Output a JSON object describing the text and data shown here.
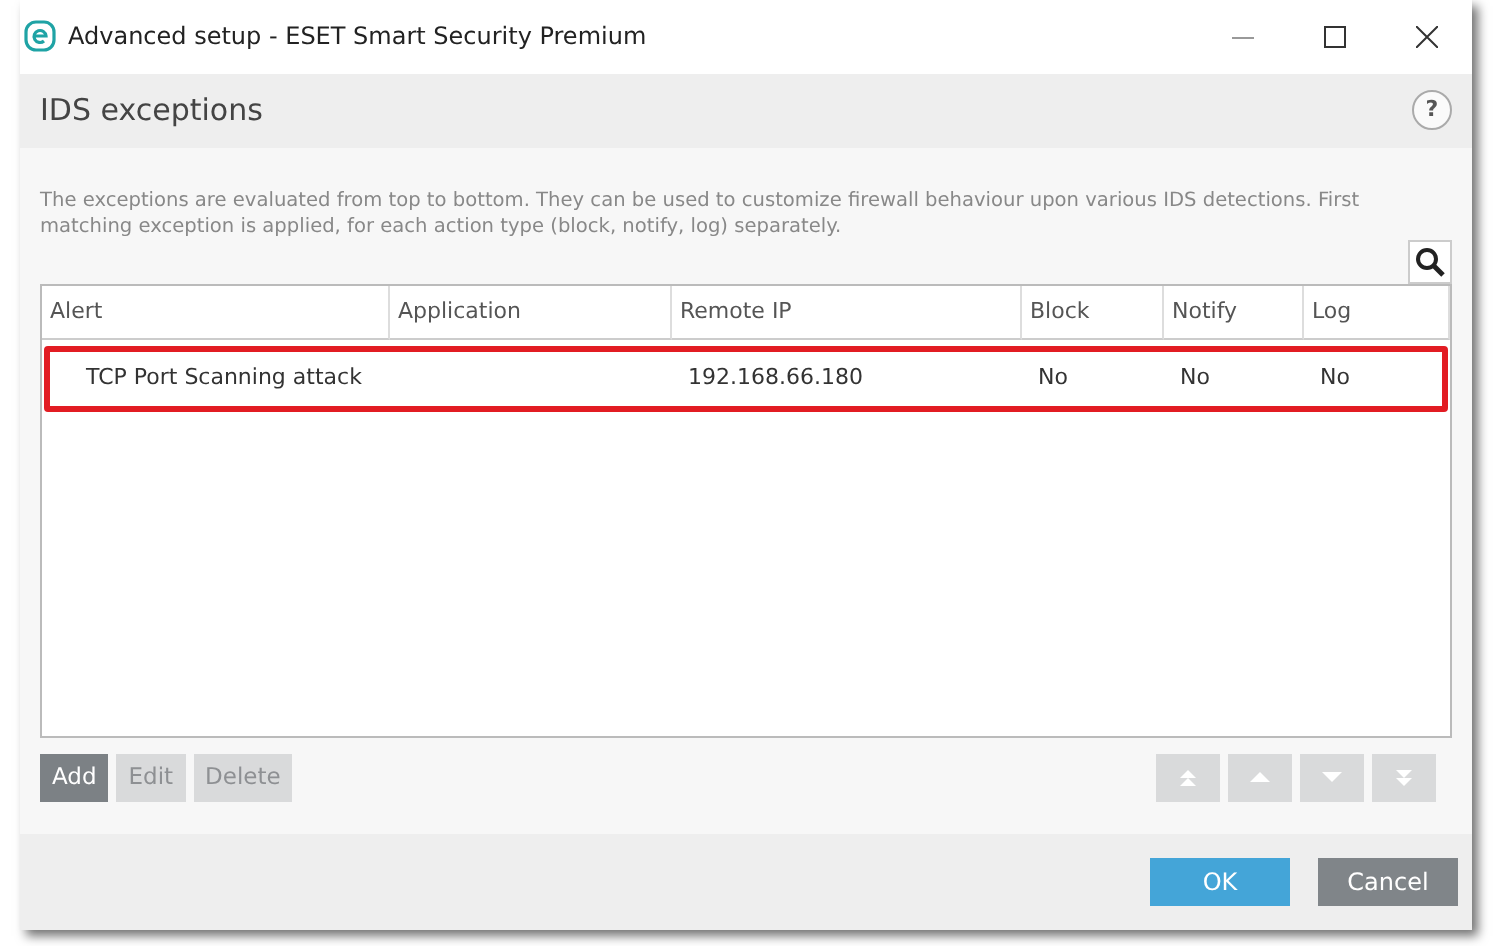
{
  "window": {
    "title": "Advanced setup - ESET Smart Security Premium"
  },
  "header": {
    "title": "IDS exceptions",
    "help": "?"
  },
  "description": "The exceptions are evaluated from top to bottom. They can be used to customize firewall behaviour upon various IDS detections. First matching exception is applied, for each action type (block, notify, log) separately.",
  "table": {
    "columns": [
      "Alert",
      "Application",
      "Remote IP",
      "Block",
      "Notify",
      "Log"
    ],
    "rows": [
      {
        "cells": [
          "TCP Port Scanning attack",
          "",
          "192.168.66.180",
          "No",
          "No",
          "No"
        ],
        "highlighted": true
      }
    ]
  },
  "actions": [
    {
      "label": "Add",
      "disabled": false
    },
    {
      "label": "Edit",
      "disabled": true
    },
    {
      "label": "Delete",
      "disabled": true
    }
  ],
  "move_buttons": [
    {
      "kind": "top",
      "disabled": true
    },
    {
      "kind": "up",
      "disabled": true
    },
    {
      "kind": "down",
      "disabled": true
    },
    {
      "kind": "bottom",
      "disabled": true
    }
  ],
  "footer": [
    {
      "label": "OK",
      "kind": "primary"
    },
    {
      "label": "Cancel",
      "kind": "secondary"
    }
  ]
}
